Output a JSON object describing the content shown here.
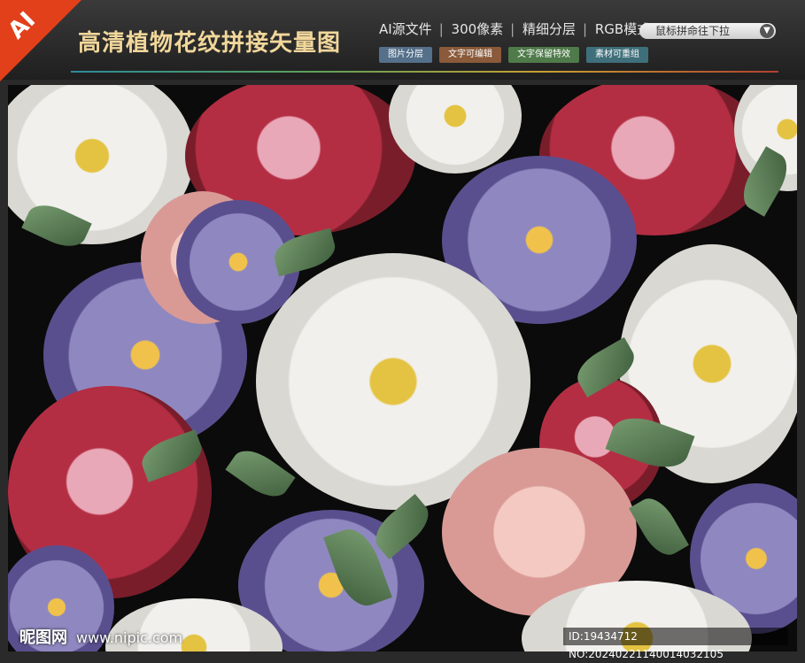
{
  "badge": {
    "label": "AI"
  },
  "header": {
    "title": "高清植物花纹拼接矢量图",
    "specs": [
      "AI源文件",
      "300像素",
      "精细分层",
      "RGB模式"
    ],
    "tags": [
      "图片分层",
      "文字可编辑",
      "文字保留特效",
      "素材可重组"
    ],
    "scroll_hint": "鼠标拼命往下拉",
    "scroll_arrow": "▼"
  },
  "footer": {
    "brand": "昵图网",
    "url": "www.nipic.com",
    "id_text": "ID:19434712 NO:20240221140014032105"
  },
  "colors": {
    "badge": "#e2401a",
    "title": "#f1d79a",
    "canvas_bg": "#0b0b0b"
  },
  "icons": {
    "scroll_arrow": "chevron-down-icon"
  }
}
